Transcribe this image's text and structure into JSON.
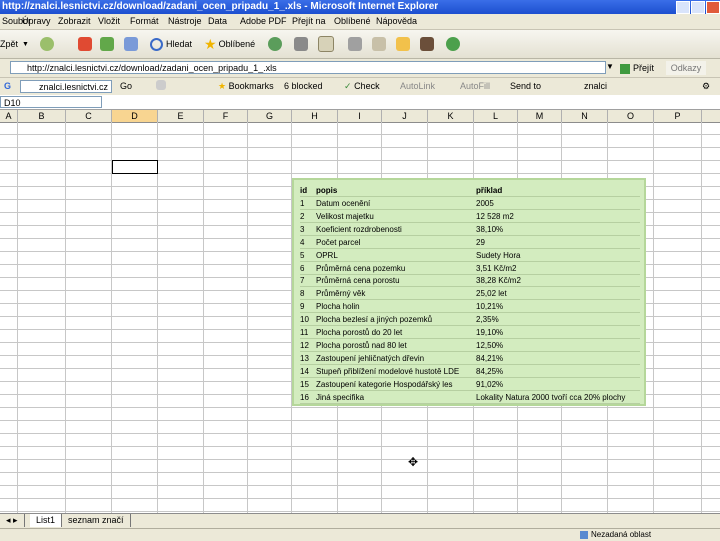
{
  "window": {
    "title": "http://znalci.lesnictvi.cz/download/zadani_ocen_pripadu_1_.xls - Microsoft Internet Explorer"
  },
  "menu": [
    "Soubor",
    "Úpravy",
    "Zobrazit",
    "Vložit",
    "Formát",
    "Nástroje",
    "Data",
    "Adobe PDF",
    "Přejít na",
    "Oblíbené",
    "Nápověda"
  ],
  "toolbar": {
    "back_label": "Zpět",
    "search_label": "Hledat",
    "favorites_label": "Oblíbené"
  },
  "address": {
    "url": "http://znalci.lesnictvi.cz/download/zadani_ocen_pripadu_1_.xls",
    "go_label": "Přejít",
    "links_label": "Odkazy"
  },
  "google": {
    "search_value": "znalci.lesnictvi.cz",
    "go_label": "Go",
    "bookmarks_label": "Bookmarks",
    "blocked_label": "6 blocked",
    "check_label": "Check",
    "autolink_label": "AutoLink",
    "autofill_label": "AutoFill",
    "sendto_label": "Send to",
    "znalci_label": "znalci"
  },
  "formula": {
    "namebox": "D10"
  },
  "grid": {
    "columns": [
      "A",
      "B",
      "C",
      "D",
      "E",
      "F",
      "G",
      "H",
      "I",
      "J",
      "K",
      "L",
      "M",
      "N",
      "O",
      "P"
    ],
    "selected_column": "D"
  },
  "table": {
    "headers": {
      "id": "id",
      "popis": "popis",
      "prikLad": "příklad"
    },
    "rows": [
      {
        "id": "1",
        "popis": "Datum ocenění",
        "prikLad": "2005"
      },
      {
        "id": "2",
        "popis": "Velikost majetku",
        "prikLad": "12 528 m2"
      },
      {
        "id": "3",
        "popis": "Koeficient rozdrobenosti",
        "prikLad": "38,10%"
      },
      {
        "id": "4",
        "popis": "Počet parcel",
        "prikLad": "29"
      },
      {
        "id": "5",
        "popis": "OPRL",
        "prikLad": "Sudety Hora"
      },
      {
        "id": "6",
        "popis": "Průměrná cena pozemku",
        "prikLad": "3,51 Kč/m2"
      },
      {
        "id": "7",
        "popis": "Průměrná cena porostu",
        "prikLad": "38,28 Kč/m2"
      },
      {
        "id": "8",
        "popis": "Průměrný věk",
        "prikLad": "25,02 let"
      },
      {
        "id": "9",
        "popis": "Plocha holin",
        "prikLad": "10,21%"
      },
      {
        "id": "10",
        "popis": "Plocha bezlesí a jiných pozemků",
        "prikLad": "2,35%"
      },
      {
        "id": "11",
        "popis": "Plocha porostů do 20 let",
        "prikLad": "19,10%"
      },
      {
        "id": "12",
        "popis": "Plocha porostů nad 80 let",
        "prikLad": "12,50%"
      },
      {
        "id": "13",
        "popis": "Zastoupení jehličnatých dřevin",
        "prikLad": "84,21%"
      },
      {
        "id": "14",
        "popis": "Stupeň přiblížení modelové hustotě LDE",
        "prikLad": "84,25%"
      },
      {
        "id": "15",
        "popis": "Zastoupení kategorie Hospodářský les",
        "prikLad": "91,02%"
      },
      {
        "id": "16",
        "popis": "Jiná specifika",
        "prikLad": "Lokality Natura 2000 tvoří cca 20% plochy"
      }
    ]
  },
  "sheets": {
    "tab1": "List1",
    "tab2": "seznam značí"
  },
  "status": {
    "zone": "Nezadaná oblast"
  },
  "colors": {
    "title_bar": "#1c4fcf",
    "table_bg": "#d3ecbf",
    "selected_col": "#f8d591"
  }
}
